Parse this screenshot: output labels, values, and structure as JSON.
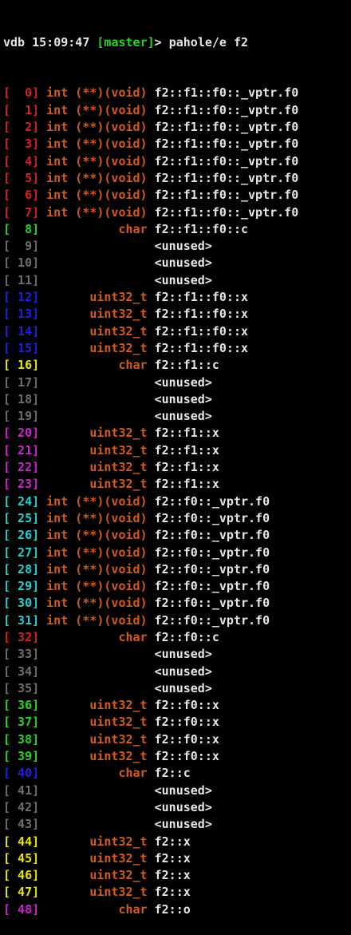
{
  "prompt": {
    "host": "vdb",
    "time": "15:09:47",
    "branch": "[master]",
    "symbol": ">",
    "command": "pahole/e f2"
  },
  "colors": {
    "red": "#d42020",
    "green": "#22d622",
    "gray": "#6e6e6e",
    "blue": "#2020e0",
    "yellow": "#e6e600",
    "magenta": "#d020d0",
    "cyan": "#20d0d0",
    "type": "#d45a1a",
    "text": "#e6e6e6"
  },
  "rows": [
    {
      "index": "0",
      "color": "red",
      "type": "int (**)(void)",
      "name": "f2::f1::f0::_vptr.f0"
    },
    {
      "index": "1",
      "color": "red",
      "type": "int (**)(void)",
      "name": "f2::f1::f0::_vptr.f0"
    },
    {
      "index": "2",
      "color": "red",
      "type": "int (**)(void)",
      "name": "f2::f1::f0::_vptr.f0"
    },
    {
      "index": "3",
      "color": "red",
      "type": "int (**)(void)",
      "name": "f2::f1::f0::_vptr.f0"
    },
    {
      "index": "4",
      "color": "red",
      "type": "int (**)(void)",
      "name": "f2::f1::f0::_vptr.f0"
    },
    {
      "index": "5",
      "color": "red",
      "type": "int (**)(void)",
      "name": "f2::f1::f0::_vptr.f0"
    },
    {
      "index": "6",
      "color": "red",
      "type": "int (**)(void)",
      "name": "f2::f1::f0::_vptr.f0"
    },
    {
      "index": "7",
      "color": "red",
      "type": "int (**)(void)",
      "name": "f2::f1::f0::_vptr.f0"
    },
    {
      "index": "8",
      "color": "green",
      "type": "char",
      "name": "f2::f1::f0::c"
    },
    {
      "index": "9",
      "color": "gray",
      "type": "",
      "name": "<unused>"
    },
    {
      "index": "10",
      "color": "gray",
      "type": "",
      "name": "<unused>"
    },
    {
      "index": "11",
      "color": "gray",
      "type": "",
      "name": "<unused>"
    },
    {
      "index": "12",
      "color": "blue",
      "type": "uint32_t",
      "name": "f2::f1::f0::x"
    },
    {
      "index": "13",
      "color": "blue",
      "type": "uint32_t",
      "name": "f2::f1::f0::x"
    },
    {
      "index": "14",
      "color": "blue",
      "type": "uint32_t",
      "name": "f2::f1::f0::x"
    },
    {
      "index": "15",
      "color": "blue",
      "type": "uint32_t",
      "name": "f2::f1::f0::x"
    },
    {
      "index": "16",
      "color": "yellow",
      "type": "char",
      "name": "f2::f1::c"
    },
    {
      "index": "17",
      "color": "gray",
      "type": "",
      "name": "<unused>"
    },
    {
      "index": "18",
      "color": "gray",
      "type": "",
      "name": "<unused>"
    },
    {
      "index": "19",
      "color": "gray",
      "type": "",
      "name": "<unused>"
    },
    {
      "index": "20",
      "color": "magenta",
      "type": "uint32_t",
      "name": "f2::f1::x"
    },
    {
      "index": "21",
      "color": "magenta",
      "type": "uint32_t",
      "name": "f2::f1::x"
    },
    {
      "index": "22",
      "color": "magenta",
      "type": "uint32_t",
      "name": "f2::f1::x"
    },
    {
      "index": "23",
      "color": "magenta",
      "type": "uint32_t",
      "name": "f2::f1::x"
    },
    {
      "index": "24",
      "color": "cyan",
      "type": "int (**)(void)",
      "name": "f2::f0::_vptr.f0"
    },
    {
      "index": "25",
      "color": "cyan",
      "type": "int (**)(void)",
      "name": "f2::f0::_vptr.f0"
    },
    {
      "index": "26",
      "color": "cyan",
      "type": "int (**)(void)",
      "name": "f2::f0::_vptr.f0"
    },
    {
      "index": "27",
      "color": "cyan",
      "type": "int (**)(void)",
      "name": "f2::f0::_vptr.f0"
    },
    {
      "index": "28",
      "color": "cyan",
      "type": "int (**)(void)",
      "name": "f2::f0::_vptr.f0"
    },
    {
      "index": "29",
      "color": "cyan",
      "type": "int (**)(void)",
      "name": "f2::f0::_vptr.f0"
    },
    {
      "index": "30",
      "color": "cyan",
      "type": "int (**)(void)",
      "name": "f2::f0::_vptr.f0"
    },
    {
      "index": "31",
      "color": "cyan",
      "type": "int (**)(void)",
      "name": "f2::f0::_vptr.f0"
    },
    {
      "index": "32",
      "color": "red",
      "type": "char",
      "name": "f2::f0::c"
    },
    {
      "index": "33",
      "color": "gray",
      "type": "",
      "name": "<unused>"
    },
    {
      "index": "34",
      "color": "gray",
      "type": "",
      "name": "<unused>"
    },
    {
      "index": "35",
      "color": "gray",
      "type": "",
      "name": "<unused>"
    },
    {
      "index": "36",
      "color": "green",
      "type": "uint32_t",
      "name": "f2::f0::x"
    },
    {
      "index": "37",
      "color": "green",
      "type": "uint32_t",
      "name": "f2::f0::x"
    },
    {
      "index": "38",
      "color": "green",
      "type": "uint32_t",
      "name": "f2::f0::x"
    },
    {
      "index": "39",
      "color": "green",
      "type": "uint32_t",
      "name": "f2::f0::x"
    },
    {
      "index": "40",
      "color": "blue",
      "type": "char",
      "name": "f2::c"
    },
    {
      "index": "41",
      "color": "gray",
      "type": "",
      "name": "<unused>"
    },
    {
      "index": "42",
      "color": "gray",
      "type": "",
      "name": "<unused>"
    },
    {
      "index": "43",
      "color": "gray",
      "type": "",
      "name": "<unused>"
    },
    {
      "index": "44",
      "color": "yellow",
      "type": "uint32_t",
      "name": "f2::x"
    },
    {
      "index": "45",
      "color": "yellow",
      "type": "uint32_t",
      "name": "f2::x"
    },
    {
      "index": "46",
      "color": "yellow",
      "type": "uint32_t",
      "name": "f2::x"
    },
    {
      "index": "47",
      "color": "yellow",
      "type": "uint32_t",
      "name": "f2::x"
    },
    {
      "index": "48",
      "color": "magenta",
      "type": "char",
      "name": "f2::o"
    }
  ]
}
